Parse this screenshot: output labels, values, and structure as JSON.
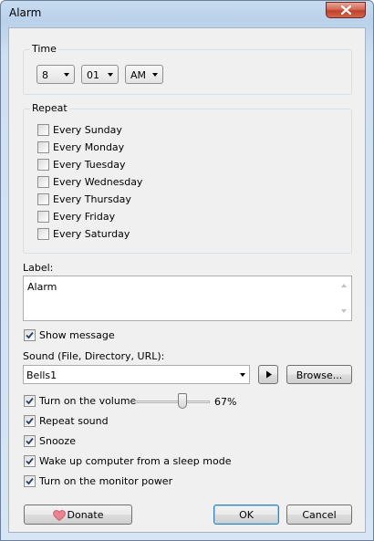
{
  "window": {
    "title": "Alarm"
  },
  "time": {
    "group_label": "Time",
    "hour": "8",
    "minute": "01",
    "ampm": "AM"
  },
  "repeat": {
    "group_label": "Repeat",
    "days": [
      {
        "label": "Every Sunday",
        "checked": false
      },
      {
        "label": "Every Monday",
        "checked": false
      },
      {
        "label": "Every Tuesday",
        "checked": false
      },
      {
        "label": "Every Wednesday",
        "checked": false
      },
      {
        "label": "Every Thursday",
        "checked": false
      },
      {
        "label": "Every Friday",
        "checked": false
      },
      {
        "label": "Every Saturday",
        "checked": false
      }
    ]
  },
  "label_field": {
    "caption": "Label:",
    "value": "Alarm"
  },
  "show_message": {
    "label": "Show message",
    "checked": true
  },
  "sound": {
    "caption": "Sound (File, Directory, URL):",
    "value": "Bells1",
    "browse_label": "Browse..."
  },
  "volume": {
    "label": "Turn on the volume",
    "checked": true,
    "percent_text": "67%",
    "level": 0.67
  },
  "options": [
    {
      "label": "Repeat sound",
      "checked": true
    },
    {
      "label": "Snooze",
      "checked": true
    },
    {
      "label": "Wake up computer from a sleep mode",
      "checked": true
    },
    {
      "label": "Turn on the monitor power",
      "checked": true
    }
  ],
  "buttons": {
    "donate": "Donate",
    "ok": "OK",
    "cancel": "Cancel"
  },
  "icons": {
    "close": "close-icon",
    "heart": "heart-icon",
    "play": "play-icon",
    "checkmark": "checkmark-icon"
  }
}
